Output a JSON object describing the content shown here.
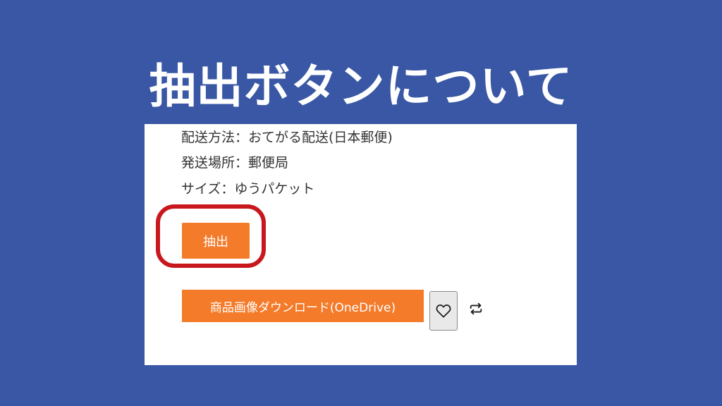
{
  "header": {
    "title": "抽出ボタンについて"
  },
  "product_info": {
    "shipping_method": "配送方法：おてがる配送(日本郵便)",
    "shipping_origin": "発送場所：郵便局",
    "size": "サイズ：ゆうパケット"
  },
  "actions": {
    "extract_label": "抽出",
    "download_label": "商品画像ダウンロード(OneDrive)",
    "favorite_icon": "heart-icon",
    "repost_icon": "repeat-icon"
  },
  "colors": {
    "background": "#3957a4",
    "button_accent": "#f47b2a",
    "highlight_ring": "#c8181e"
  }
}
